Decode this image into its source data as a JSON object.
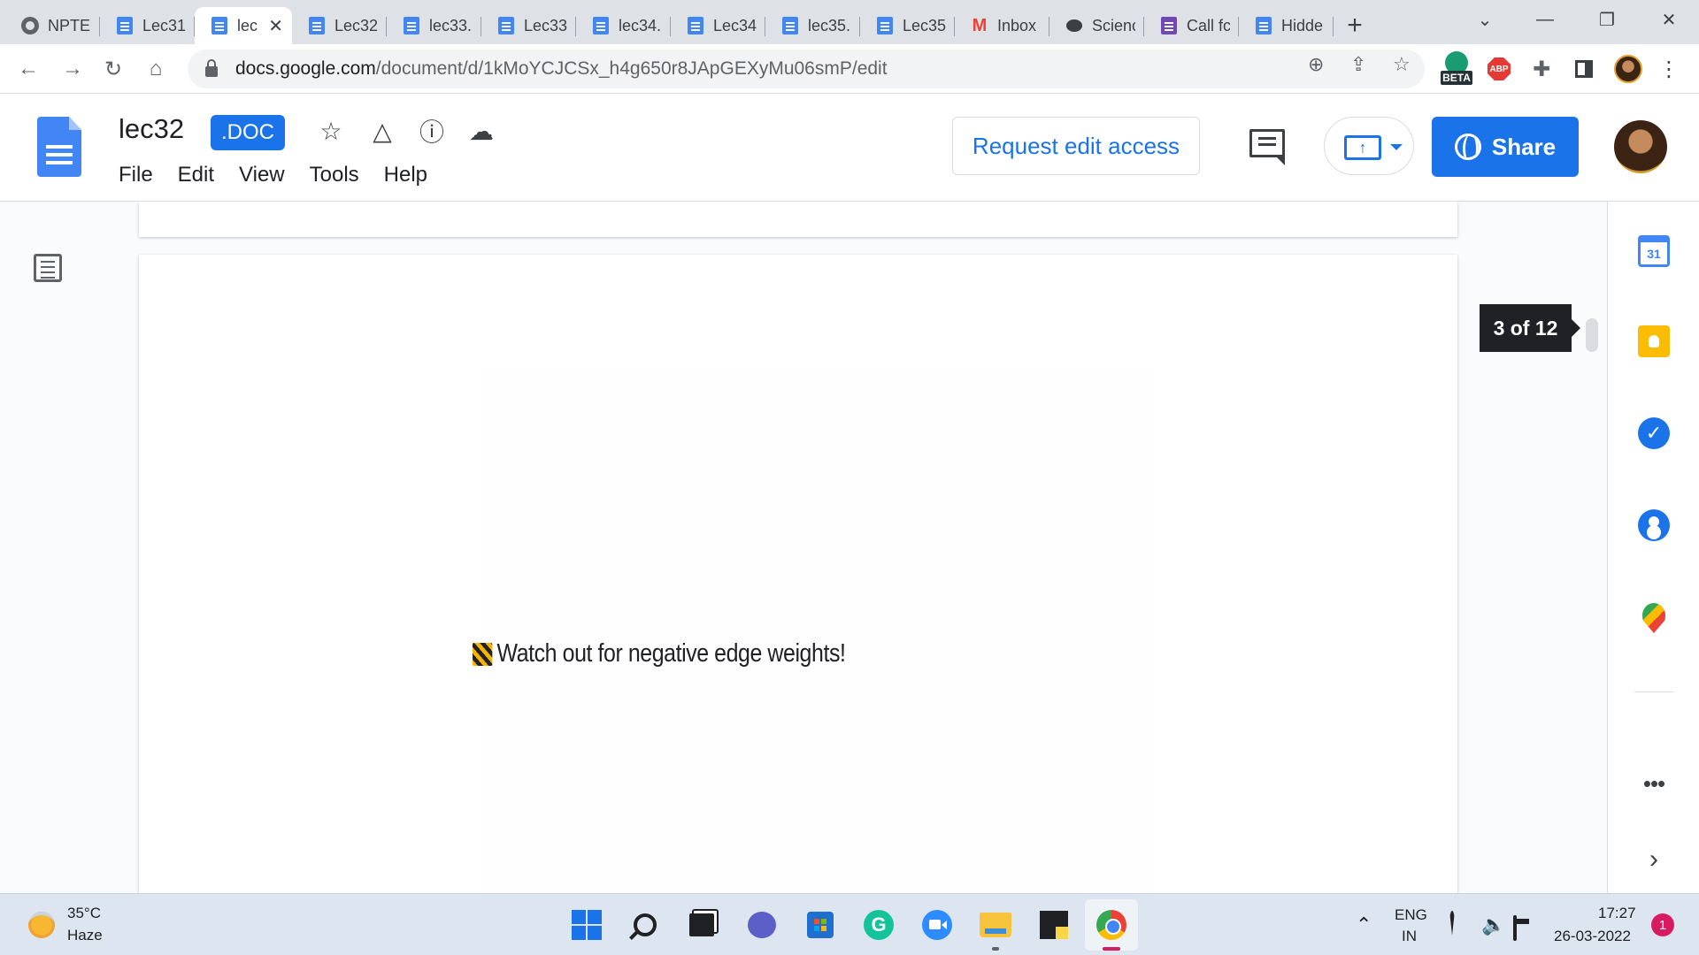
{
  "browser": {
    "tabs": [
      {
        "title": "NPTEL",
        "icon": "globe-icon",
        "active": false
      },
      {
        "title": "Lec31",
        "icon": "docs-icon",
        "active": false
      },
      {
        "title": "lec",
        "icon": "docs-icon",
        "active": true
      },
      {
        "title": "Lec32",
        "icon": "docs-icon",
        "active": false
      },
      {
        "title": "lec33.",
        "icon": "docs-icon",
        "active": false
      },
      {
        "title": "Lec33",
        "icon": "docs-icon",
        "active": false
      },
      {
        "title": "lec34.",
        "icon": "docs-icon",
        "active": false
      },
      {
        "title": "Lec34",
        "icon": "docs-icon",
        "active": false
      },
      {
        "title": "lec35.",
        "icon": "docs-icon",
        "active": false
      },
      {
        "title": "Lec35",
        "icon": "docs-icon",
        "active": false
      },
      {
        "title": "Inbox",
        "icon": "gmail-icon",
        "active": false
      },
      {
        "title": "Scienc",
        "icon": "chat-icon",
        "active": false
      },
      {
        "title": "Call fc",
        "icon": "forms-icon",
        "active": false
      },
      {
        "title": "Hidde",
        "icon": "docs-icon",
        "active": false
      }
    ],
    "new_tab_label": "+",
    "close_tab_glyph": "✕",
    "url_host": "docs.google.com",
    "url_path": "/document/d/1kMoYCJCSx_h4g650r8JApGEXyMu06smP/edit",
    "beta_label": "BETA",
    "abp_label": "ABP"
  },
  "docs": {
    "title": "lec32",
    "format_badge": ".DOC",
    "menu": [
      "File",
      "Edit",
      "View",
      "Tools",
      "Help"
    ],
    "request_edit_label": "Request edit access",
    "share_label": "Share",
    "page_counter": "3 of 12",
    "page_text": "Watch out for negative edge weights!",
    "calendar_day": "31",
    "tasks_glyph": "✓",
    "more_glyph": "•••",
    "expand_glyph": "›"
  },
  "taskbar": {
    "temperature": "35°C",
    "weather": "Haze",
    "lang_top": "ENG",
    "lang_bottom": "IN",
    "time": "17:27",
    "date": "26-03-2022",
    "notifications": "1",
    "grammarly_glyph": "G"
  },
  "colors": {
    "accent": "#1a73e8",
    "docs_blue": "#4285f4",
    "notification": "#d81b60"
  }
}
